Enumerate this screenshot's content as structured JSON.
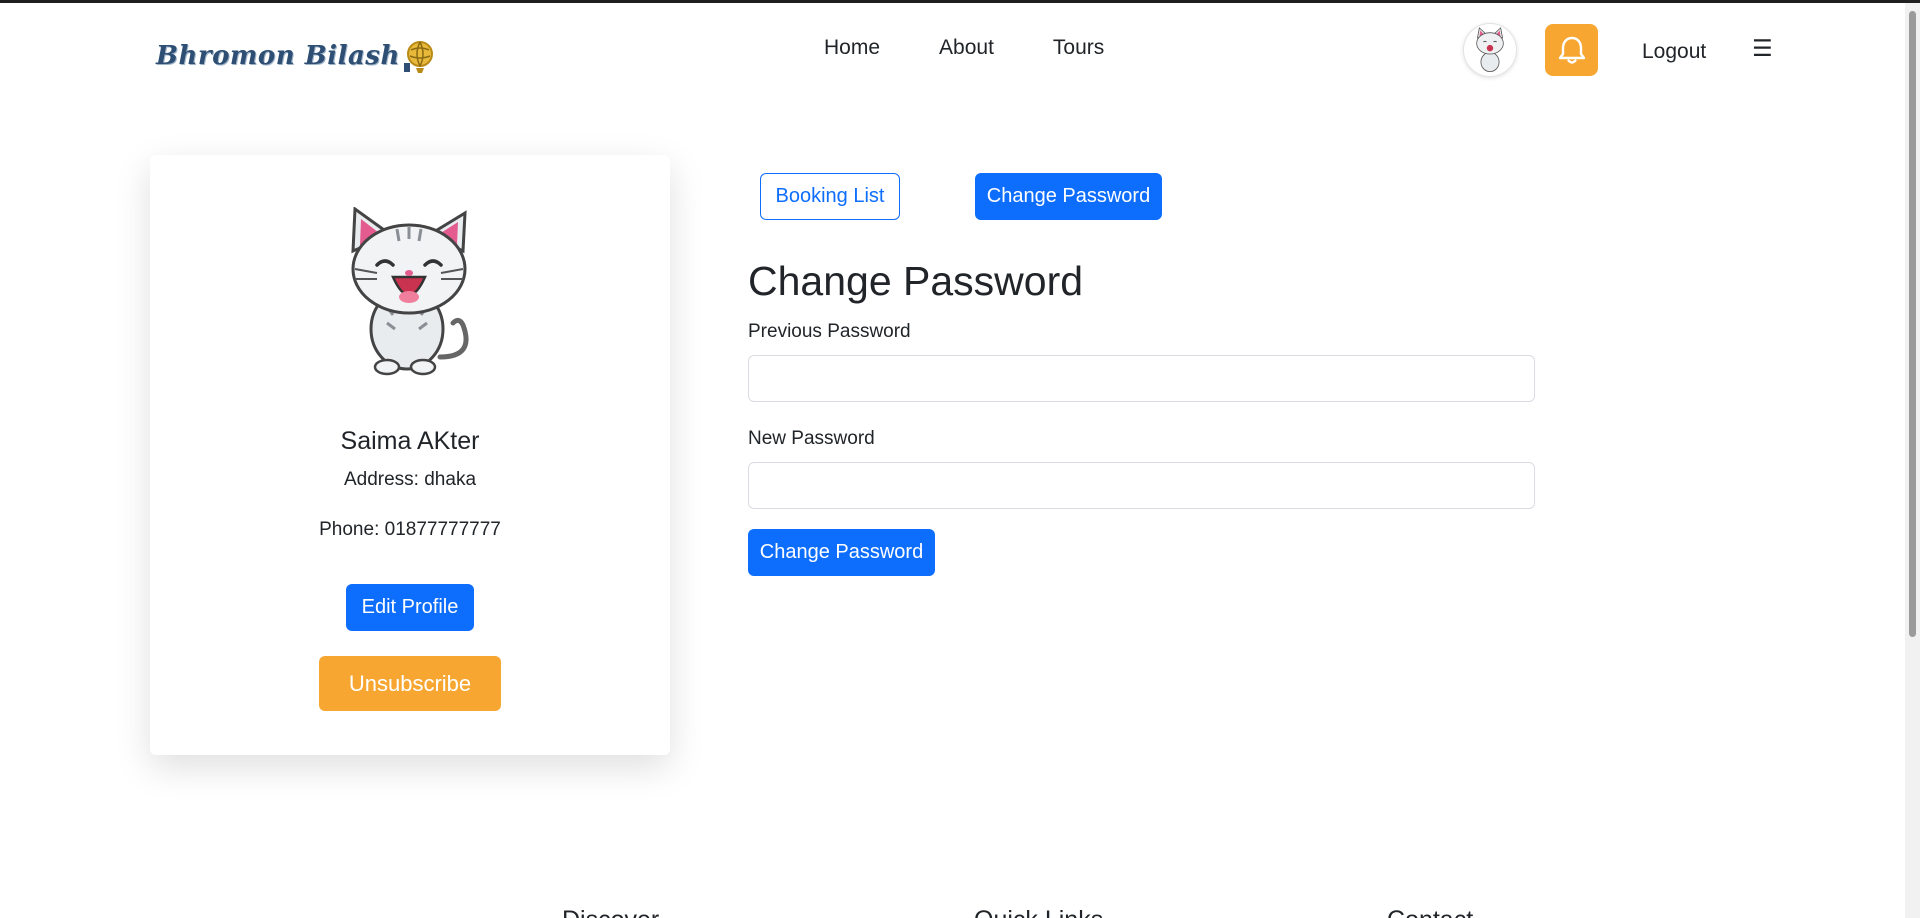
{
  "brand": {
    "name": "Bhromon Bilash"
  },
  "nav": {
    "links": [
      "Home",
      "About",
      "Tours"
    ],
    "logout_label": "Logout",
    "menu_glyph": "☰"
  },
  "profile": {
    "name": "Saima AKter",
    "address": "Address: dhaka",
    "phone": "Phone: 01877777777",
    "edit_label": "Edit Profile",
    "unsubscribe_label": "Unsubscribe"
  },
  "tabs": {
    "booking_label": "Booking List",
    "change_label": "Change Password"
  },
  "form": {
    "title": "Change Password",
    "previous_label": "Previous Password",
    "previous_value": "",
    "new_label": "New Password",
    "new_value": "",
    "submit_label": "Change Password"
  },
  "footer": {
    "headings": [
      "Discover",
      "Quick Links",
      "Contact"
    ]
  },
  "colors": {
    "primary": "#0d6efd",
    "accent": "#f7a731",
    "text": "#212529",
    "brand": "#2e4f73"
  },
  "icons": [
    "globe-icon",
    "cat-avatar-icon",
    "bell-icon",
    "hamburger-menu-icon"
  ]
}
